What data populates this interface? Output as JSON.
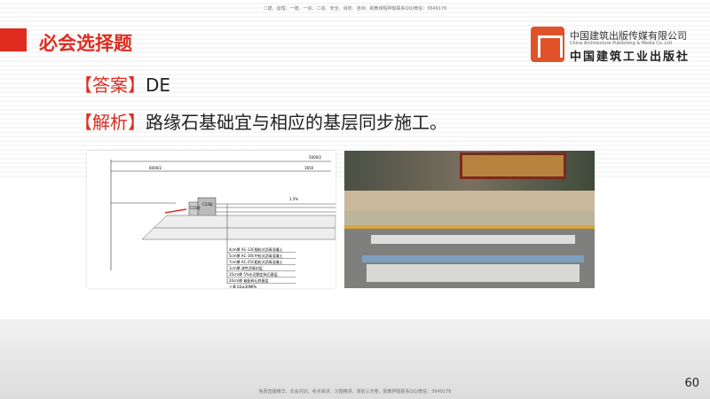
{
  "header": {
    "top_note": "二建、监理、一建、一造、二造、安全、消防、咨询、助教课程押题联系QQ/微信：3649176",
    "title": "必会选择题"
  },
  "logo": {
    "name_cn": "中国建筑出版传媒有限公司",
    "name_en": "China Architecture Publishing & Media Co.,Ltd",
    "name_cn2": "中国建筑工业出版社"
  },
  "content": {
    "answer_label": "【答案】",
    "answer": "DE",
    "explain_label": "【解析】",
    "explain": "路缘石基础宜与相应的基层同步施工。"
  },
  "diagram": {
    "dim_total": "5000/2",
    "dim_left": "6000/2",
    "dim_right": "1650",
    "curb1": "C15砼",
    "curb2": "C15砼",
    "slope": "1.5%",
    "layers": [
      "4cm厚 AC-13C细粒式沥青混凝土",
      "5cm厚 AC-16C中粒式沥青混凝土",
      "7cm厚 AC-25C粗粒式沥青混凝土",
      "1cm厚 改性沥青封层",
      "35cm厚 5%水泥稳定碎石基层",
      "20cm厚 级配碎石底基层",
      "土基 E0≥30MPa"
    ]
  },
  "footer": {
    "note": "免费直播精华、本会内训、考点串讲、习题精讲、课前三天卷、助教押题联系QQ/微信：3649176",
    "page": "60"
  }
}
